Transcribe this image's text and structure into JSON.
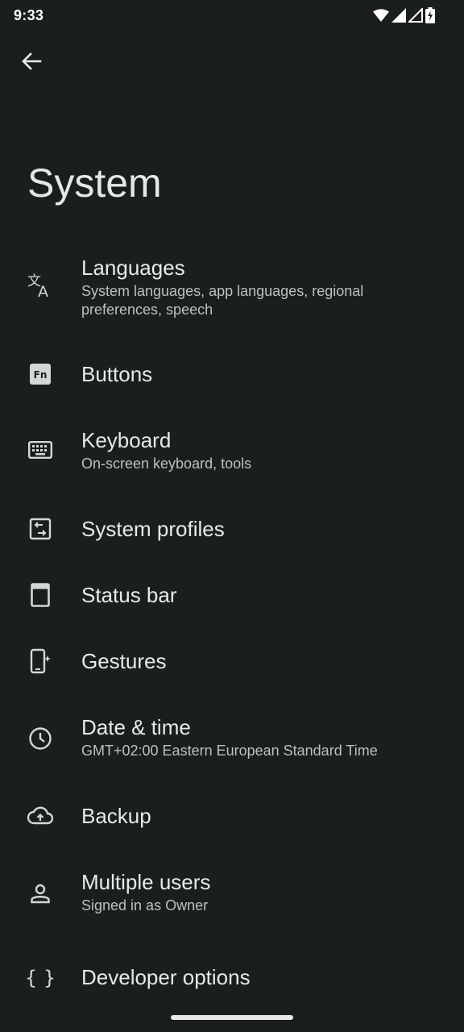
{
  "status_bar": {
    "time": "9:33",
    "icons": [
      "wifi-icon",
      "signal-icon",
      "signal-2-icon",
      "battery-charging-icon"
    ]
  },
  "header": {
    "back_icon": "arrow-left-icon",
    "title": "System"
  },
  "items": [
    {
      "icon": "translate-icon",
      "title": "Languages",
      "subtitle": "System languages, app languages, regional preferences, speech"
    },
    {
      "icon": "fn-key-icon",
      "title": "Buttons",
      "subtitle": ""
    },
    {
      "icon": "keyboard-icon",
      "title": "Keyboard",
      "subtitle": "On-screen keyboard, tools"
    },
    {
      "icon": "profile-toggle-icon",
      "title": "System profiles",
      "subtitle": ""
    },
    {
      "icon": "status-bar-icon",
      "title": "Status bar",
      "subtitle": ""
    },
    {
      "icon": "phone-gesture-icon",
      "title": "Gestures",
      "subtitle": ""
    },
    {
      "icon": "clock-icon",
      "title": "Date & time",
      "subtitle": "GMT+02:00 Eastern European Standard Time"
    },
    {
      "icon": "cloud-upload-icon",
      "title": "Backup",
      "subtitle": ""
    },
    {
      "icon": "person-icon",
      "title": "Multiple users",
      "subtitle": "Signed in as Owner"
    },
    {
      "icon": "braces-icon",
      "title": "Developer options",
      "subtitle": ""
    }
  ],
  "colors": {
    "background": "#1a1f1d",
    "text_primary": "#e8eae7",
    "text_secondary": "#bcc1bd"
  }
}
